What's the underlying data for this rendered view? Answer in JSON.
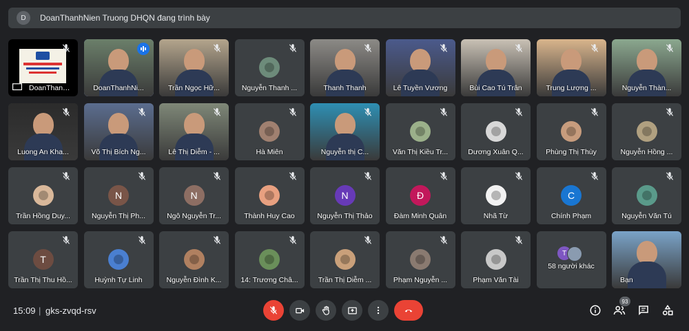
{
  "banner": {
    "avatar": "D",
    "text": "DoanThanhNien Truong DHQN đang trình bày"
  },
  "tiles": [
    {
      "name": "DoanThanhNi...",
      "kind": "present"
    },
    {
      "name": "DoanThanhNi...",
      "kind": "video",
      "bg": "#6b7f6a",
      "speaking": true
    },
    {
      "name": "Trần Ngọc Hữ...",
      "kind": "video",
      "bg": "#b4a58d"
    },
    {
      "name": "Nguyễn Thanh ...",
      "kind": "photo",
      "ac": "#6d8b7a"
    },
    {
      "name": "Thanh Thanh",
      "kind": "video",
      "bg": "#8c8a86"
    },
    {
      "name": "Lê Tuyền Vương",
      "kind": "video",
      "bg": "#4b5a8c"
    },
    {
      "name": "Bùi Cao Tú Trân",
      "kind": "video",
      "bg": "#c9c1b5"
    },
    {
      "name": "Trung Lượng ...",
      "kind": "video",
      "bg": "#d9b58c"
    },
    {
      "name": "Nguyễn Thàn...",
      "kind": "video",
      "bg": "#8ba88f"
    },
    {
      "name": "Luong An Kha...",
      "kind": "video",
      "bg": "#2b2b2b"
    },
    {
      "name": "Võ Thị Bích Ng...",
      "kind": "video",
      "bg": "#5b6d8f"
    },
    {
      "name": "Lê Thị Diễm - ...",
      "kind": "video",
      "bg": "#7f8878"
    },
    {
      "name": "Hà Miên",
      "kind": "photo",
      "ac": "#a08070"
    },
    {
      "name": "Nguyễn thị C...",
      "kind": "video",
      "bg": "#2e8fb3"
    },
    {
      "name": "Văn Thị Kiều Tr...",
      "kind": "photo",
      "ac": "#9bb08a"
    },
    {
      "name": "Dương Xuân Q...",
      "kind": "photo",
      "ac": "#d8d8d8"
    },
    {
      "name": "Phùng Thị Thùy",
      "kind": "photo",
      "ac": "#c79c7d"
    },
    {
      "name": "Nguyễn Hồng ...",
      "kind": "photo",
      "ac": "#b0a080"
    },
    {
      "name": "Trần Hồng Duy...",
      "kind": "photo",
      "ac": "#d9b89a"
    },
    {
      "name": "Nguyễn Thị Ph...",
      "kind": "letter",
      "letter": "N",
      "ac": "#795548"
    },
    {
      "name": "Ngô Nguyễn Tr...",
      "kind": "letter",
      "letter": "N",
      "ac": "#8d6e63"
    },
    {
      "name": "Thành Huy Cao",
      "kind": "photo",
      "ac": "#e8a080"
    },
    {
      "name": "Nguyễn Thị Thảo",
      "kind": "letter",
      "letter": "N",
      "ac": "#673ab7"
    },
    {
      "name": "Đàm Minh Quân",
      "kind": "letter",
      "letter": "Đ",
      "ac": "#c2185b"
    },
    {
      "name": "Nhã Từ",
      "kind": "photo",
      "ac": "#f2f2f2"
    },
    {
      "name": "Chính Phạm",
      "kind": "letter",
      "letter": "C",
      "ac": "#1976d2"
    },
    {
      "name": "Nguyễn Văn Tú",
      "kind": "photo",
      "ac": "#5a9a8a"
    },
    {
      "name": "Trần Thị Thu Hồ...",
      "kind": "letter",
      "letter": "T",
      "ac": "#6d4c41"
    },
    {
      "name": "Huỳnh Tự Linh",
      "kind": "photo",
      "ac": "#4a7fd0"
    },
    {
      "name": "Nguyễn Đình K...",
      "kind": "photo",
      "ac": "#b08060"
    },
    {
      "name": "14: Trương Châ...",
      "kind": "photo",
      "ac": "#6a8f5a"
    },
    {
      "name": "Trần Thị Diễm ...",
      "kind": "photo",
      "ac": "#c9a07a"
    },
    {
      "name": "Phạm Nguyễn ...",
      "kind": "photo",
      "ac": "#8a7a70"
    },
    {
      "name": "Phạm Văn Tài",
      "kind": "photo",
      "ac": "#c8c8c8"
    },
    {
      "name": "58 người khác",
      "kind": "more",
      "letter": "T"
    },
    {
      "name": "Bạn",
      "kind": "self",
      "bg": "#7aa3c8"
    }
  ],
  "bottom": {
    "time": "15:09",
    "separator": "|",
    "code": "gks-zvqd-rsv",
    "participants_count": "93"
  },
  "colors": {
    "bg": "#202124",
    "tile": "#3c4043",
    "red": "#ea4335",
    "accent": "#8ab4f8"
  }
}
